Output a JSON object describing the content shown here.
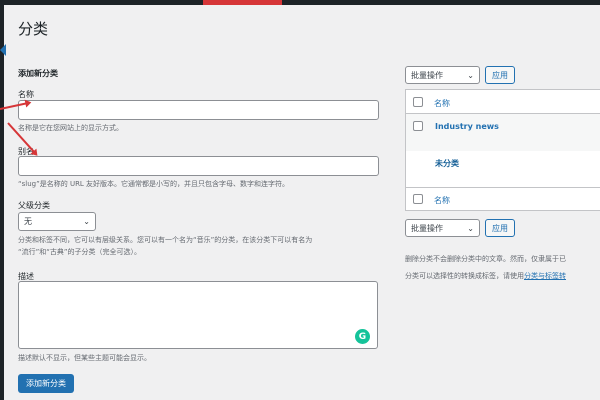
{
  "page_title": "分类",
  "form": {
    "heading": "添加新分类",
    "name_label": "名称",
    "name_value": "",
    "name_help": "名称是它在您网站上的显示方式。",
    "slug_label": "别名",
    "slug_value": "",
    "slug_help": "“slug”是名称的 URL 友好版本。它通常都是小写的，并且只包含字母、数字和连字符。",
    "parent_label": "父级分类",
    "parent_value": "无",
    "parent_help_1": "分类和标签不同，它可以有层级关系。您可以有一个名为“音乐”的分类，在该分类下可以有名为",
    "parent_help_2": "“流行”和“古典”的子分类（完全可选）。",
    "desc_label": "描述",
    "desc_value": "",
    "desc_help": "描述默认不显示，但某些主题可能会显示。",
    "submit": "添加新分类"
  },
  "list": {
    "bulk_action": "批量操作",
    "apply": "应用",
    "header_name": "名称",
    "rows": [
      {
        "name": "Industry news"
      },
      {
        "name": "未分类"
      }
    ],
    "footer_name": "名称",
    "note_1": "删除分类不会删除分类中的文章。然而，仅隶属于已",
    "note_2": "分类可以选择性的转换成标签，请使用",
    "note_link": "分类与标签转"
  },
  "colors": {
    "accent": "#2271b1",
    "arrow": "#d63638",
    "grammarly": "#15c39a"
  }
}
